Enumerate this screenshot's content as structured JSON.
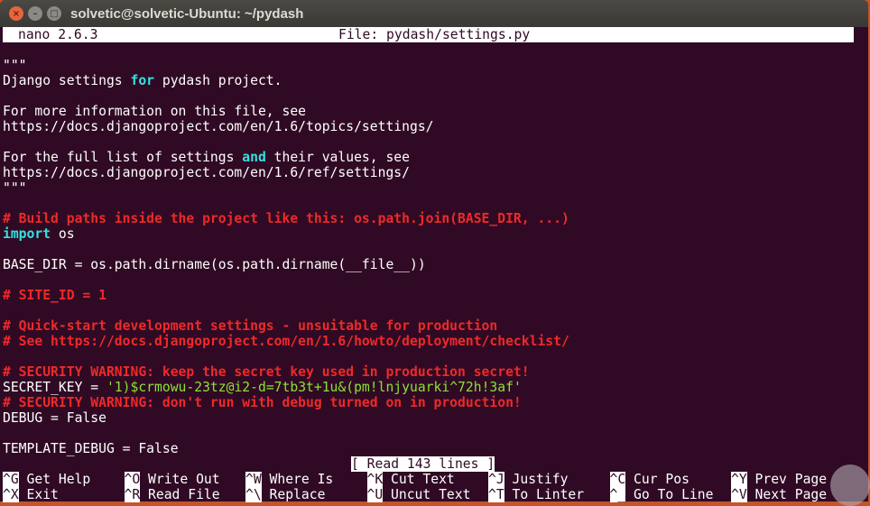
{
  "window": {
    "title": "solvetic@solvetic-Ubuntu: ~/pydash"
  },
  "nano": {
    "version": "nano 2.6.3",
    "file": "File: pydash/settings.py",
    "status": "[ Read 143 lines ]"
  },
  "lines": [
    [
      {
        "t": "\"\"\"",
        "c": ""
      }
    ],
    [
      {
        "t": "Django settings ",
        "c": ""
      },
      {
        "t": "for",
        "c": "kw"
      },
      {
        "t": " pydash project.",
        "c": ""
      }
    ],
    [],
    [
      {
        "t": "For more information on this file, see",
        "c": ""
      }
    ],
    [
      {
        "t": "https://docs.djangoproject.com/en/1.6/topics/settings/",
        "c": ""
      }
    ],
    [],
    [
      {
        "t": "For the full list of settings ",
        "c": ""
      },
      {
        "t": "and",
        "c": "kw"
      },
      {
        "t": " their values, see",
        "c": ""
      }
    ],
    [
      {
        "t": "https://docs.djangoproject.com/en/1.6/ref/settings/",
        "c": ""
      }
    ],
    [
      {
        "t": "\"\"\"",
        "c": ""
      }
    ],
    [],
    [
      {
        "t": "# Build paths inside the project like this: os.path.join(BASE_DIR, ...)",
        "c": "comment"
      }
    ],
    [
      {
        "t": "import",
        "c": "kw"
      },
      {
        "t": " os",
        "c": ""
      }
    ],
    [],
    [
      {
        "t": "BASE_DIR = os.path.dirname(os.path.dirname(__file__))",
        "c": ""
      }
    ],
    [],
    [
      {
        "t": "# SITE_ID = 1",
        "c": "comment"
      }
    ],
    [],
    [
      {
        "t": "# Quick-start development settings - unsuitable for production",
        "c": "comment"
      }
    ],
    [
      {
        "t": "# See https://docs.djangoproject.com/en/1.6/howto/deployment/checklist/",
        "c": "comment"
      }
    ],
    [],
    [
      {
        "t": "# SECURITY WARNING: keep the secret key used in production secret!",
        "c": "comment"
      }
    ],
    [
      {
        "t": "SECRET_KEY = ",
        "c": ""
      },
      {
        "t": "'1)$crmowu-23tz@i2-d=7tb3t+1u&(pm!lnjyuarki^72h!3af'",
        "c": "str"
      }
    ],
    [
      {
        "t": "# SECURITY WARNING: don't run with debug turned on in production!",
        "c": "comment"
      }
    ],
    [
      {
        "t": "DEBUG = False",
        "c": ""
      }
    ],
    [],
    [
      {
        "t": "TEMPLATE_DEBUG = False",
        "c": ""
      }
    ]
  ],
  "shortcuts": [
    [
      {
        "key": "^G",
        "label": "Get Help"
      },
      {
        "key": "^X",
        "label": "Exit"
      }
    ],
    [
      {
        "key": "^O",
        "label": "Write Out"
      },
      {
        "key": "^R",
        "label": "Read File"
      }
    ],
    [
      {
        "key": "^W",
        "label": "Where Is"
      },
      {
        "key": "^\\",
        "label": "Replace"
      }
    ],
    [
      {
        "key": "^K",
        "label": "Cut Text"
      },
      {
        "key": "^U",
        "label": "Uncut Text"
      }
    ],
    [
      {
        "key": "^J",
        "label": "Justify"
      },
      {
        "key": "^T",
        "label": "To Linter"
      }
    ],
    [
      {
        "key": "^C",
        "label": "Cur Pos"
      },
      {
        "key": "^_",
        "label": "Go To Line"
      }
    ],
    [
      {
        "key": "^Y",
        "label": "Prev Page"
      },
      {
        "key": "^V",
        "label": "Next Page"
      }
    ]
  ]
}
